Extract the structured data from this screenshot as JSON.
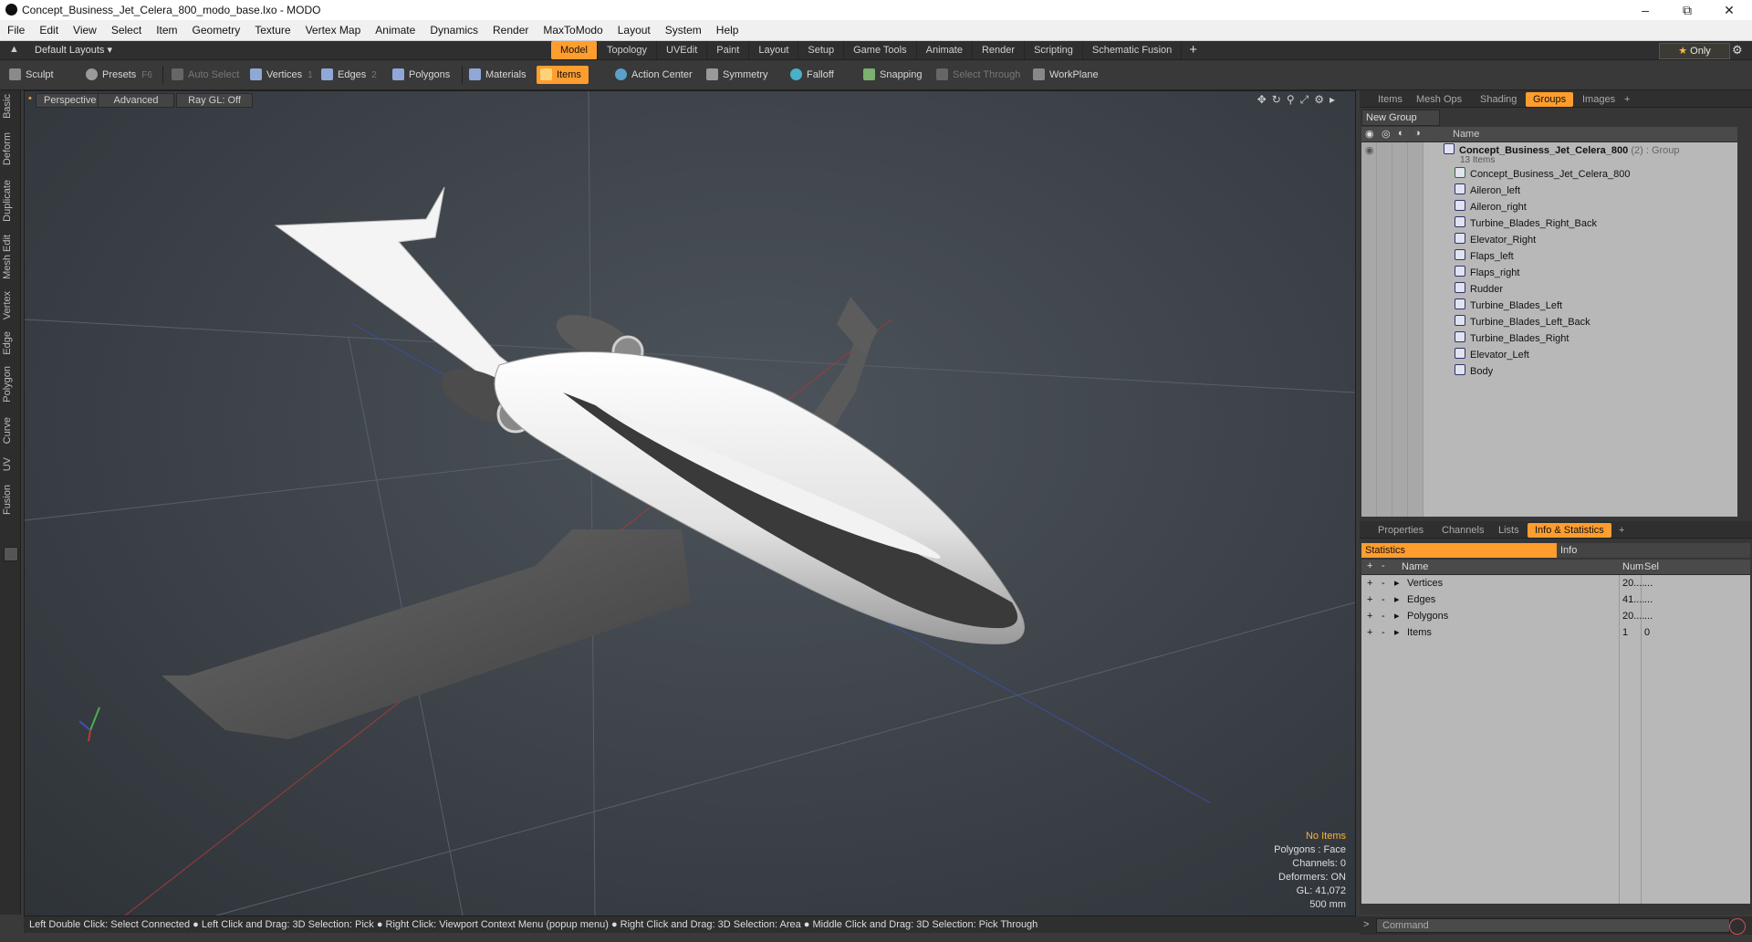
{
  "window": {
    "title": "Concept_Business_Jet_Celera_800_modo_base.lxo - MODO"
  },
  "menu": [
    "File",
    "Edit",
    "View",
    "Select",
    "Item",
    "Geometry",
    "Texture",
    "Vertex Map",
    "Animate",
    "Dynamics",
    "Render",
    "MaxToModo",
    "Layout",
    "System",
    "Help"
  ],
  "layouts": {
    "label": "Default Layouts ▾",
    "tabs": [
      "Model",
      "Topology",
      "UVEdit",
      "Paint",
      "Layout",
      "Setup",
      "Game Tools",
      "Animate",
      "Render",
      "Scripting",
      "Schematic Fusion"
    ],
    "active_tab": "Model",
    "only_label": "Only"
  },
  "toolbar": {
    "sculpt": "Sculpt",
    "presets": "Presets",
    "presets_key": "F6",
    "auto_select": "Auto Select",
    "vertices": "Vertices",
    "vertices_key": "1",
    "edges": "Edges",
    "edges_key": "2",
    "polygons": "Polygons",
    "materials": "Materials",
    "items": "Items",
    "action_center": "Action Center",
    "symmetry": "Symmetry",
    "falloff": "Falloff",
    "snapping": "Snapping",
    "select_through": "Select Through",
    "workplane": "WorkPlane"
  },
  "left_tabs": [
    "Basic",
    "Deform",
    "Duplicate",
    "Mesh Edit",
    "Vertex",
    "Edge",
    "Polygon",
    "Curve",
    "UV",
    "Fusion"
  ],
  "viewport": {
    "perspective": "Perspective",
    "advanced": "Advanced",
    "raygl": "Ray GL: Off",
    "info": {
      "no_items": "No Items",
      "polygons": "Polygons : Face",
      "channels": "Channels: 0",
      "deformers": "Deformers: ON",
      "gl": "GL: 41,072",
      "scale": "500 mm"
    }
  },
  "right_tabs_top": [
    "Items",
    "Mesh Ops",
    "Shading",
    "Groups",
    "Images"
  ],
  "right_active_top": "Groups",
  "groups": {
    "new_group": "New Group",
    "name_header": "Name",
    "group_name": "Concept_Business_Jet_Celera_800",
    "group_annot": "(2) : Group",
    "group_count": "13 Items",
    "items": [
      "Concept_Business_Jet_Celera_800",
      "Aileron_left",
      "Aileron_right",
      "Turbine_Blades_Right_Back",
      "Elevator_Right",
      "Flaps_left",
      "Flaps_right",
      "Rudder",
      "Turbine_Blades_Left",
      "Turbine_Blades_Left_Back",
      "Turbine_Blades_Right",
      "Elevator_Left",
      "Body"
    ]
  },
  "right_tabs_bottom": [
    "Properties",
    "Channels",
    "Lists",
    "Info & Statistics"
  ],
  "right_active_bottom": "Info & Statistics",
  "stats": {
    "tab_statistics": "Statistics",
    "tab_info": "Info",
    "col_name": "Name",
    "col_num": "Num",
    "col_sel": "Sel",
    "rows": [
      {
        "name": "Vertices",
        "num": "20....",
        "sel": "..."
      },
      {
        "name": "Edges",
        "num": "41....",
        "sel": "..."
      },
      {
        "name": "Polygons",
        "num": "20....",
        "sel": "..."
      },
      {
        "name": "Items",
        "num": "1",
        "sel": "0"
      }
    ]
  },
  "status": "Left Double Click: Select Connected ● Left Click and Drag: 3D Selection: Pick ● Right Click: Viewport Context Menu (popup menu) ● Right Click and Drag: 3D Selection: Area ● Middle Click and Drag: 3D Selection: Pick Through",
  "command_placeholder": "Command",
  "colors": {
    "accent": "#ff9d2e",
    "viewport_bg": "#3d4349",
    "panel": "#363636"
  }
}
